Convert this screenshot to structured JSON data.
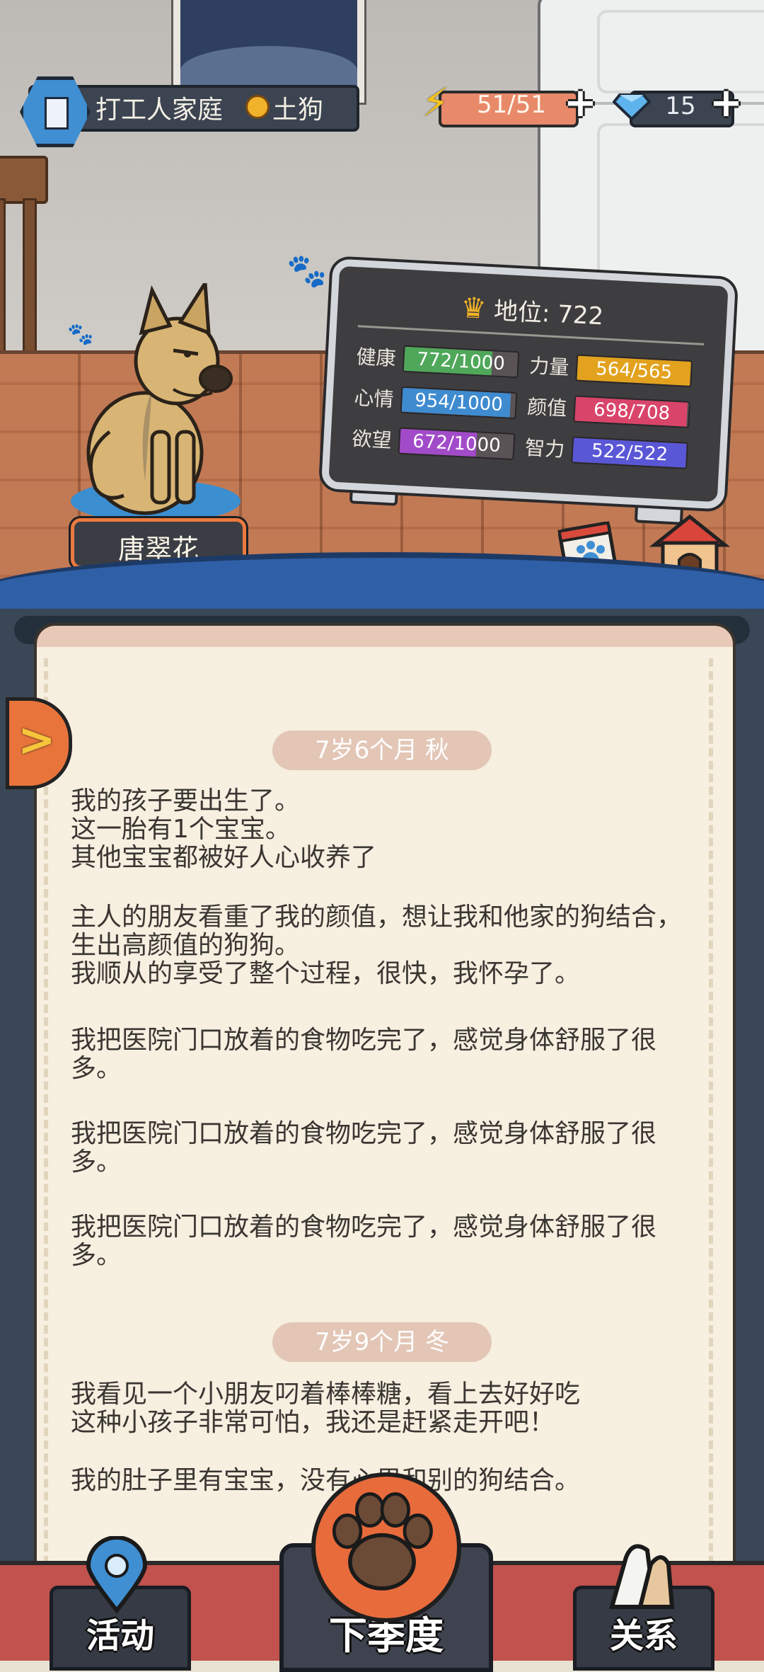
{
  "hud": {
    "family_name": "打工人家庭",
    "rank": "土狗",
    "energy": "51/51",
    "gems": "15",
    "energy_fraction": 1.0
  },
  "dog": {
    "name": "唐翠花"
  },
  "stats": {
    "status_label": "地位: 722",
    "items": [
      {
        "name": "健康",
        "value": "772/1000",
        "fraction": 0.772,
        "color": "#4fa85a"
      },
      {
        "name": "心情",
        "value": "954/1000",
        "fraction": 0.954,
        "color": "#3f8bd0"
      },
      {
        "name": "欲望",
        "value": "672/1000",
        "fraction": 0.672,
        "color": "#a24bc9"
      },
      {
        "name": "力量",
        "value": "564/565",
        "fraction": 0.998,
        "color": "#e3a21e"
      },
      {
        "name": "颜值",
        "value": "698/708",
        "fraction": 0.986,
        "color": "#d9456a"
      },
      {
        "name": "智力",
        "value": "522/522",
        "fraction": 1.0,
        "color": "#5a57d6"
      }
    ]
  },
  "side_buttons": {
    "task": "任务",
    "kennel": "狗窝"
  },
  "log": {
    "sections": [
      {
        "season": "7岁6个月 秋",
        "paragraphs": [
          "我的孩子要出生了。\n这一胎有1个宝宝。\n其他宝宝都被好人心收养了",
          "主人的朋友看重了我的颜值，想让我和他家的狗结合，生出高颜值的狗狗。\n我顺从的享受了整个过程，很快，我怀孕了。",
          "我把医院门口放着的食物吃完了，感觉身体舒服了很多。",
          "我把医院门口放着的食物吃完了，感觉身体舒服了很多。",
          "我把医院门口放着的食物吃完了，感觉身体舒服了很多。"
        ]
      },
      {
        "season": "7岁9个月 冬",
        "paragraphs": [
          "我看见一个小朋友叼着棒棒糖，看上去好好吃\n这种小孩子非常可怕，我还是赶紧走开吧！",
          "我的肚子里有宝宝，没有心思和别的狗结合。"
        ]
      }
    ]
  },
  "nav": {
    "activity": "活动",
    "next_season": "下季度",
    "relations": "关系"
  },
  "icons": {
    "family": "building-icon",
    "rank": "medal-icon",
    "energy": "lightning-icon",
    "gem": "diamond-icon",
    "crown": "crown-icon",
    "expand": "chevron-right-icon",
    "task": "notepad-paw-icon",
    "kennel": "doghouse-icon",
    "activity": "map-pin-icon",
    "next": "paw-icon",
    "relations": "handshake-icon"
  }
}
